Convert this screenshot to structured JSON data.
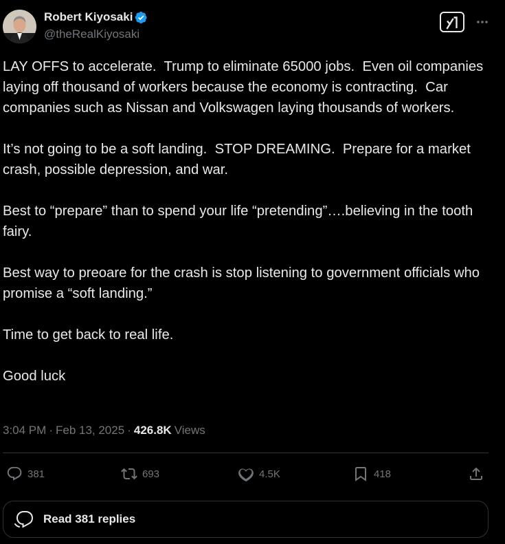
{
  "author": {
    "display_name": "Robert Kiyosaki",
    "handle": "@theRealKiyosaki",
    "verified": true
  },
  "header": {
    "grok_icon": "grok-icon",
    "more_icon": "more-options-icon"
  },
  "tweet": {
    "paragraphs": [
      "LAY OFFS to accelerate.  Trump to eliminate 65000 jobs.  Even oil companies laying off thousand of workers because the economy is contracting.  Car companies such as Nissan and Volkswagen laying thousands of workers.",
      "It’s not going to be a soft landing.  STOP DREAMING.  Prepare for a market crash, possible depression, and war.",
      "Best to “prepare” than to spend your life “pretending”….believing in the tooth fairy.",
      "Best way to preoare for the crash is stop listening to government officials who promise a “soft landing.”",
      "Time to get back to real life.",
      "Good luck"
    ]
  },
  "meta": {
    "time": "3:04 PM",
    "date": "Feb 13, 2025",
    "separator": "·",
    "views_count": "426.8K",
    "views_label": "Views"
  },
  "actions": {
    "replies": "381",
    "reposts": "693",
    "likes": "4.5K",
    "bookmarks": "418"
  },
  "read_replies": {
    "label": "Read 381 replies"
  },
  "colors": {
    "background": "#000000",
    "text": "#e7e9ea",
    "secondary": "#71767b",
    "verified": "#1d9bf0",
    "border": "#2f3336"
  }
}
